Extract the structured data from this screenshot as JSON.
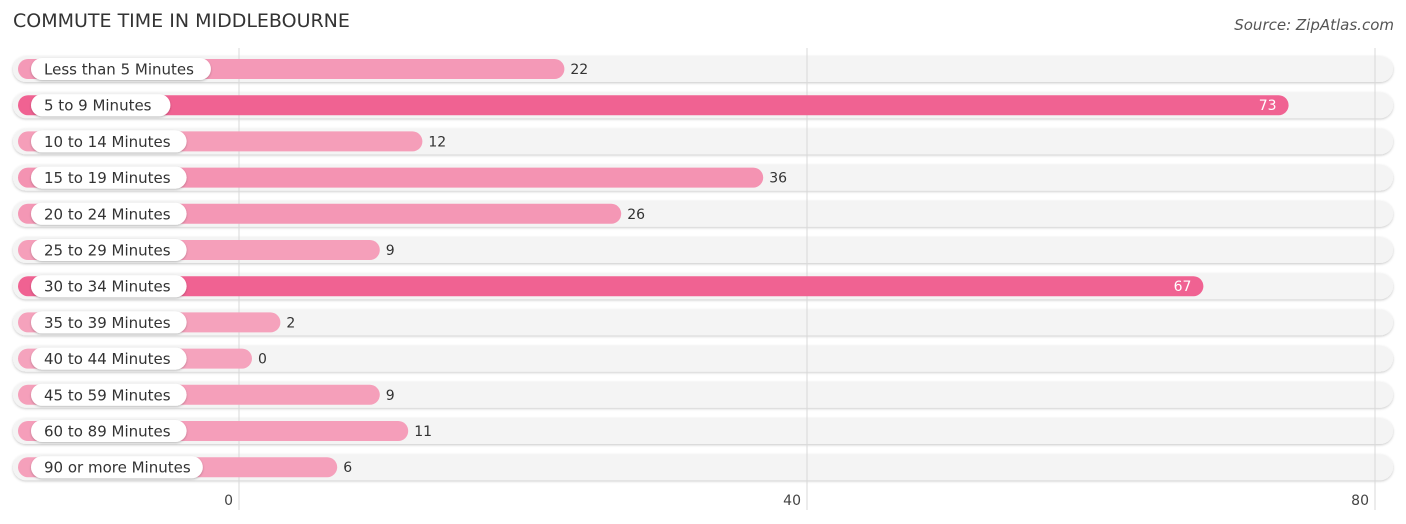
{
  "title": "COMMUTE TIME IN MIDDLEBOURNE",
  "source": "Source: ZipAtlas.com",
  "colors": {
    "bar_strong": "#f06292",
    "bar_light": "#f5a3bd",
    "track": "#f4f4f4",
    "label_inside": "#ffffff",
    "label_outside": "#333333"
  },
  "chart_data": {
    "type": "bar",
    "orientation": "horizontal",
    "title": "COMMUTE TIME IN MIDDLEBOURNE",
    "xlabel": "",
    "ylabel": "",
    "categories": [
      "Less than 5 Minutes",
      "5 to 9 Minutes",
      "10 to 14 Minutes",
      "15 to 19 Minutes",
      "20 to 24 Minutes",
      "25 to 29 Minutes",
      "30 to 34 Minutes",
      "35 to 39 Minutes",
      "40 to 44 Minutes",
      "45 to 59 Minutes",
      "60 to 89 Minutes",
      "90 or more Minutes"
    ],
    "values": [
      22,
      73,
      12,
      36,
      26,
      9,
      67,
      2,
      0,
      9,
      11,
      6
    ],
    "xlim": [
      0,
      80
    ],
    "xticks": [
      0,
      40,
      80
    ],
    "xtick_labels": [
      "0",
      "40",
      "80"
    ],
    "grid": true,
    "legend": "none",
    "value_labels_inside_threshold": 60
  }
}
